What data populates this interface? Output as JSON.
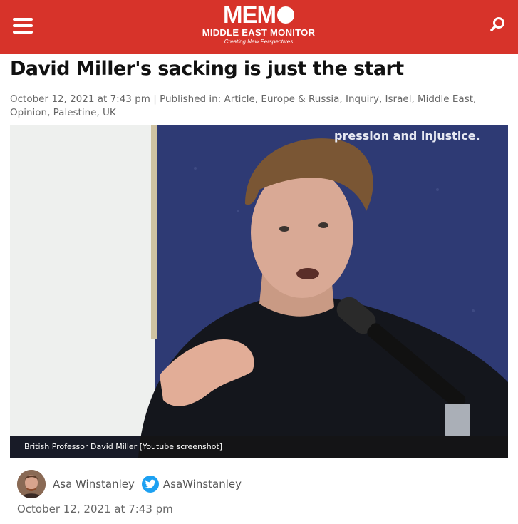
{
  "header": {
    "brand": "MEM",
    "subtitle": "MIDDLE EAST MONITOR",
    "tagline": "Creating New Perspectives",
    "accent_color": "#d7332a",
    "menu_icon": "hamburger-menu-icon",
    "search_icon": "search-icon"
  },
  "article": {
    "headline": "David Miller's sacking is just the start",
    "date": "October 12, 2021 at 7:43 pm",
    "separator": "|",
    "published_label": "Published in:",
    "categories_text": "Article, Europe & Russia, Inquiry, Israel, Middle East, Opinion, Palestine, UK",
    "image_overlay_text": "pression and injustice.",
    "caption": "British Professor David Miller [Youtube screenshot]"
  },
  "author": {
    "name": "Asa Winstanley",
    "twitter_icon": "twitter-icon",
    "twitter_handle": "AsaWinstanley",
    "date": "October 12, 2021 at 7:43 pm"
  }
}
